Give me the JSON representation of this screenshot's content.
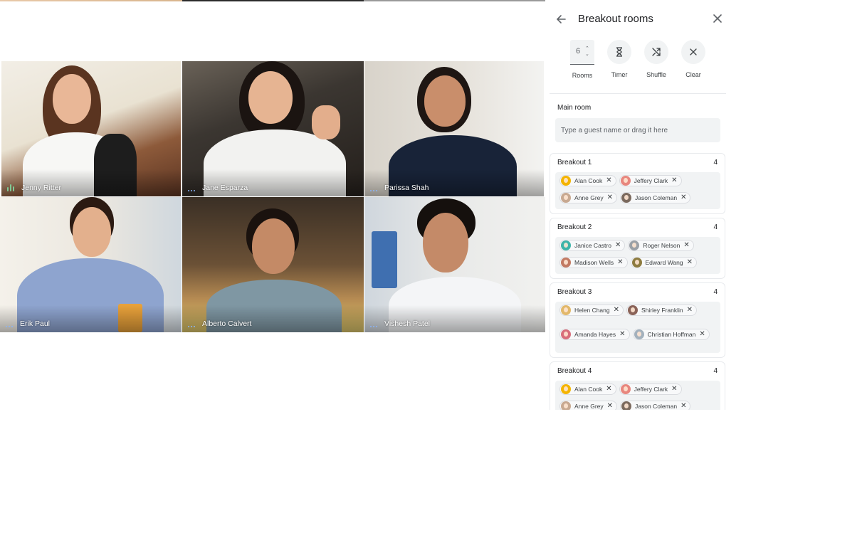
{
  "participants": [
    {
      "name": "Jenny Ritter",
      "speaking": true
    },
    {
      "name": "Jane Esparza",
      "speaking": false
    },
    {
      "name": "Parissa Shah",
      "speaking": false
    },
    {
      "name": "Erik Paul",
      "speaking": false
    },
    {
      "name": "Alberto Calvert",
      "speaking": false
    },
    {
      "name": "Vishesh Patel",
      "speaking": false
    }
  ],
  "panel": {
    "title": "Breakout rooms",
    "back_icon": "arrow-left-icon",
    "close_icon": "close-icon",
    "tools": {
      "rooms": {
        "label": "Rooms",
        "value": "6"
      },
      "timer": {
        "label": "Timer",
        "icon": "hourglass-icon"
      },
      "shuffle": {
        "label": "Shuffle",
        "icon": "shuffle-icon"
      },
      "clear": {
        "label": "Clear",
        "icon": "clear-icon"
      }
    },
    "main_room": {
      "label": "Main room",
      "placeholder": "Type a guest name or drag it here"
    },
    "rooms": [
      {
        "name": "Breakout 1",
        "count": "4",
        "members": [
          "Alan Cook",
          "Jeffery Clark",
          "Anne Grey",
          "Jason Coleman"
        ]
      },
      {
        "name": "Breakout 2",
        "count": "4",
        "members": [
          "Janice Castro",
          "Roger Nelson",
          "Madison Wells",
          "Edward Wang"
        ]
      },
      {
        "name": "Breakout 3",
        "count": "4",
        "members": [
          "Helen Chang",
          "Shirley Franklin",
          "Amanda Hayes",
          "Christian Hoffman"
        ]
      },
      {
        "name": "Breakout 4",
        "count": "4",
        "members": [
          "Alan Cook",
          "Jeffery Clark",
          "Anne Grey",
          "Jason Coleman"
        ]
      }
    ]
  },
  "colors": {
    "accent": "#1a73e8",
    "speaking": "#81c995",
    "chip_bg": "#f1f3f4"
  }
}
